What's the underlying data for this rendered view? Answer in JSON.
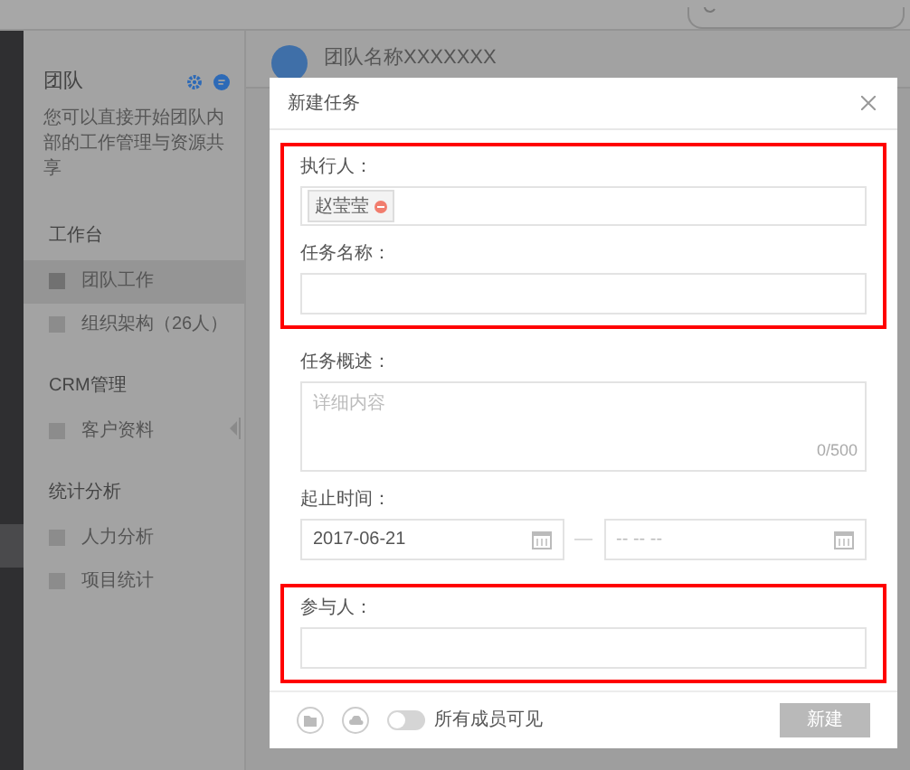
{
  "sidebar": {
    "title": "团队",
    "description": "您可以直接开始团队内部的工作管理与资源共享",
    "sections": [
      {
        "title": "工作台",
        "items": [
          {
            "label": "团队工作",
            "selected": true
          },
          {
            "label": "组织架构（26人）",
            "selected": false
          }
        ]
      },
      {
        "title": "CRM管理",
        "items": [
          {
            "label": "客户资料",
            "selected": false
          }
        ]
      },
      {
        "title": "统计分析",
        "items": [
          {
            "label": "人力分析",
            "selected": false
          },
          {
            "label": "项目统计",
            "selected": false
          }
        ]
      }
    ]
  },
  "team_header": {
    "name": "团队名称XXXXXXX"
  },
  "modal": {
    "title": "新建任务",
    "groups": [
      {
        "highlighted": true,
        "fields": [
          {
            "kind": "tags",
            "label": "执行人：",
            "tags": [
              "赵莹莹"
            ]
          },
          {
            "kind": "text",
            "label": "任务名称："
          }
        ]
      },
      {
        "highlighted": false,
        "fields": [
          {
            "kind": "textarea",
            "label": "任务概述：",
            "placeholder": "详细内容",
            "counter": "0/500"
          },
          {
            "kind": "daterange",
            "label": "起止时间：",
            "start": "2017-06-21",
            "separator": "—",
            "end": "-- -- --"
          }
        ]
      },
      {
        "highlighted": true,
        "fields": [
          {
            "kind": "text",
            "label": "参与人："
          }
        ]
      }
    ],
    "footer": {
      "visibility_toggle": {
        "on": false,
        "label": "所有成员可见"
      },
      "submit": {
        "label": "新建",
        "disabled": true
      }
    }
  }
}
